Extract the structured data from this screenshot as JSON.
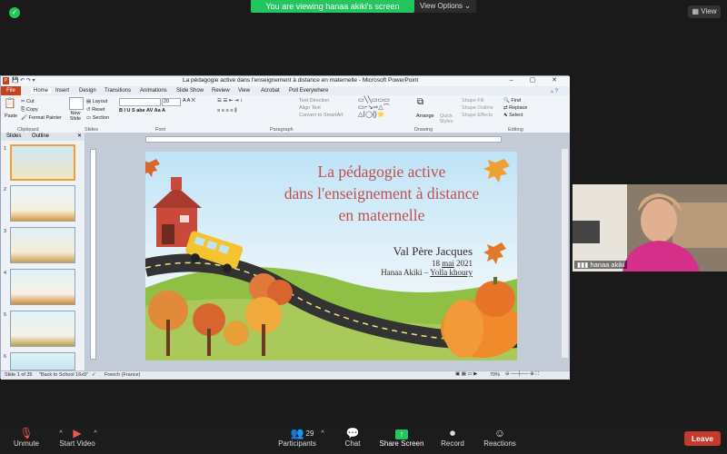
{
  "zoom": {
    "banner_text": "You are viewing hanaa akiki's screen",
    "view_options": "View Options",
    "view_button": "View",
    "participant_name": "hanaa akiki",
    "participant_count": "29",
    "toolbar": {
      "unmute": "Unmute",
      "start_video": "Start Video",
      "participants": "Participants",
      "chat": "Chat",
      "share_screen": "Share Screen",
      "record": "Record",
      "reactions": "Reactions",
      "leave": "Leave"
    },
    "colors": {
      "banner": "#22c55e",
      "leave": "#c53a2c",
      "share": "#22c55e"
    }
  },
  "ppt": {
    "window_title": "La pédagogie active  dans l'enseignement à distance  en maternelle  -  Microsoft PowerPoint",
    "menu": [
      "File",
      "Home",
      "Insert",
      "Design",
      "Transitions",
      "Animations",
      "Slide Show",
      "Review",
      "View",
      "Acrobat",
      "Poll Everywhere"
    ],
    "ribbon": {
      "paste": "Paste",
      "cut": "Cut",
      "copy": "Copy",
      "format_painter": "Format Painter",
      "new_slide": "New Slide",
      "layout": "Layout",
      "reset": "Reset",
      "section": "Section",
      "font_size": "20",
      "text_direction": "Text Direction",
      "align_text": "Align Text",
      "convert_smartart": "Convert to SmartArt",
      "arrange": "Arrange",
      "quick_styles": "Quick Styles",
      "shape_fill": "Shape Fill",
      "shape_outline": "Shape Outline",
      "shape_effects": "Shape Effects",
      "find": "Find",
      "replace": "Replace",
      "select": "Select",
      "groups": [
        "Clipboard",
        "Slides",
        "Font",
        "Paragraph",
        "Drawing",
        "Editing"
      ]
    },
    "panel_tabs": [
      "Slides",
      "Outline"
    ],
    "status": {
      "slide_count": "Slide 1 of 35",
      "theme": "\"Back to School 16x9\"",
      "language": "French (France)",
      "zoom": "70%"
    },
    "slide": {
      "title_lines": [
        "La pédagogie active",
        "dans l'enseignement à distance",
        "en maternelle"
      ],
      "school_name": "Val Père Jacques",
      "date_day": "18",
      "date_month": "mai",
      "date_year": "2021",
      "authors_prefix": "Hanaa Akiki – ",
      "authors_second": "Yolla khoury"
    }
  }
}
